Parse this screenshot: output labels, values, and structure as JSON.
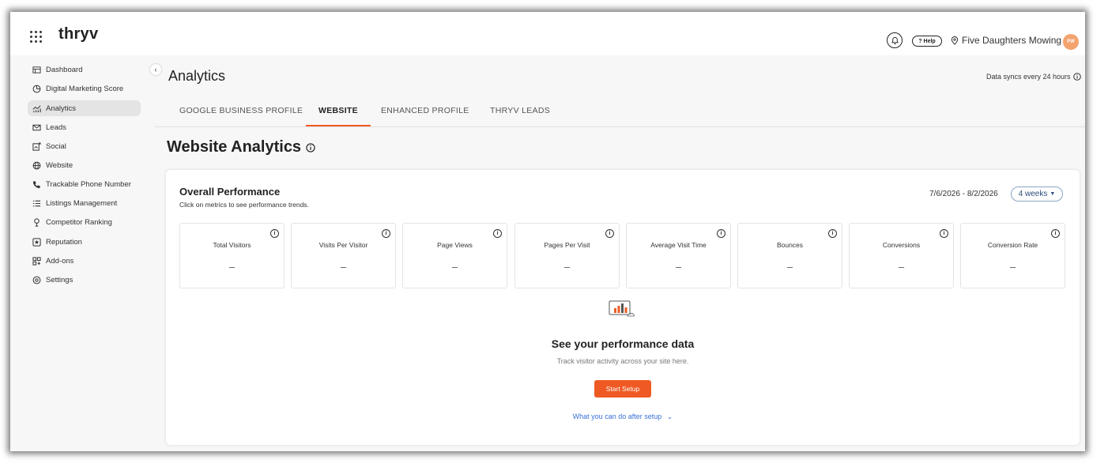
{
  "header": {
    "logo": "thryv",
    "help_label": "? Help",
    "business_name": "Five Daughters Mowing",
    "avatar_initials": "PW"
  },
  "sidebar": {
    "items": [
      {
        "label": "Dashboard",
        "icon": "dashboard-icon"
      },
      {
        "label": "Digital Marketing Score",
        "icon": "gauge-icon"
      },
      {
        "label": "Analytics",
        "icon": "analytics-icon",
        "active": true
      },
      {
        "label": "Leads",
        "icon": "mail-icon"
      },
      {
        "label": "Social",
        "icon": "social-icon"
      },
      {
        "label": "Website",
        "icon": "globe-icon"
      },
      {
        "label": "Trackable Phone Number",
        "icon": "phone-icon"
      },
      {
        "label": "Listings Management",
        "icon": "list-icon"
      },
      {
        "label": "Competitor Ranking",
        "icon": "trophy-icon"
      },
      {
        "label": "Reputation",
        "icon": "star-icon"
      },
      {
        "label": "Add-ons",
        "icon": "addons-icon"
      },
      {
        "label": "Settings",
        "icon": "gear-icon"
      }
    ]
  },
  "page": {
    "title": "Analytics",
    "sync_note": "Data syncs every 24 hours",
    "tabs": [
      {
        "label": "GOOGLE BUSINESS PROFILE"
      },
      {
        "label": "WEBSITE",
        "active": true
      },
      {
        "label": "ENHANCED PROFILE"
      },
      {
        "label": "THRYV LEADS"
      }
    ],
    "section_title": "Website Analytics"
  },
  "performance": {
    "title": "Overall Performance",
    "subtitle": "Click on metrics to see performance trends.",
    "date_range": "7/6/2026 - 8/2/2026",
    "period": "4 weeks",
    "metrics": [
      {
        "label": "Total Visitors",
        "value": "–"
      },
      {
        "label": "Visits Per Visitor",
        "value": "–"
      },
      {
        "label": "Page Views",
        "value": "–"
      },
      {
        "label": "Pages Per Visit",
        "value": "–"
      },
      {
        "label": "Average Visit Time",
        "value": "–"
      },
      {
        "label": "Bounces",
        "value": "–"
      },
      {
        "label": "Conversions",
        "value": "–"
      },
      {
        "label": "Conversion Rate",
        "value": "–"
      }
    ]
  },
  "empty_state": {
    "title": "See your performance data",
    "subtitle": "Track visitor activity across your site here.",
    "button": "Start Setup",
    "link": "What you can do after setup"
  },
  "colors": {
    "accent": "#ef5a24",
    "link": "#3a6fd8"
  }
}
